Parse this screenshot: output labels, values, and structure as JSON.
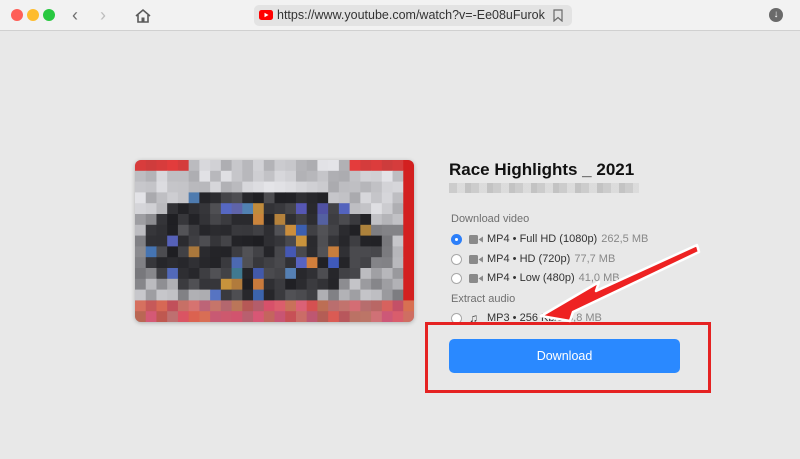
{
  "browser": {
    "url": "https://www.youtube.com/watch?v=-Ee08uFurok",
    "back_icon": "chevron-left-icon",
    "forward_icon": "chevron-right-icon",
    "home_icon": "home-icon",
    "download_icon": "download-icon"
  },
  "video": {
    "title": "Race Highlights _ 2021"
  },
  "download_video": {
    "label": "Download video",
    "options": [
      {
        "format": "MP4 • Full HD (1080p)",
        "size": "262,5 MB",
        "selected": true
      },
      {
        "format": "MP4 • HD (720p)",
        "size": "77,7 MB",
        "selected": false
      },
      {
        "format": "MP4 • Low (480p)",
        "size": "41,0 MB",
        "selected": false
      }
    ]
  },
  "extract_audio": {
    "label": "Extract audio",
    "options": [
      {
        "format": "MP3 • 256 Kb/s",
        "size": "8,8 MB",
        "selected": false
      }
    ]
  },
  "download_button": {
    "label": "Download"
  },
  "colors": {
    "accent": "#2a89ff",
    "highlight": "#e52222"
  }
}
